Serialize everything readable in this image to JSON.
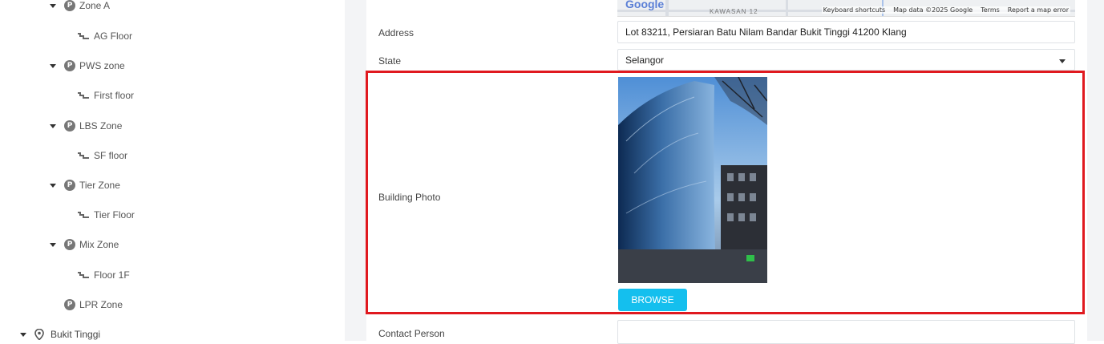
{
  "tree": {
    "nodes": [
      {
        "label": "Zone A",
        "type": "zone"
      },
      {
        "label": "AG Floor",
        "type": "floor"
      },
      {
        "label": "PWS zone",
        "type": "zone"
      },
      {
        "label": "First floor",
        "type": "floor"
      },
      {
        "label": "LBS Zone",
        "type": "zone"
      },
      {
        "label": "SF floor",
        "type": "floor"
      },
      {
        "label": "Tier Zone",
        "type": "zone"
      },
      {
        "label": "Tier Floor",
        "type": "floor"
      },
      {
        "label": "Mix Zone",
        "type": "zone"
      },
      {
        "label": "Floor 1F",
        "type": "floor"
      },
      {
        "label": "LPR Zone",
        "type": "zone"
      },
      {
        "label": "Bukit Tinggi",
        "type": "site"
      }
    ],
    "parking_icon_letter": "P"
  },
  "map": {
    "logo": "Google",
    "area_label": "KAWASAN 12",
    "footer": {
      "shortcuts": "Keyboard shortcuts",
      "data": "Map data ©2025 Google",
      "terms": "Terms",
      "report": "Report a map error"
    }
  },
  "form": {
    "address_label": "Address",
    "address_value": "Lot 83211, Persiaran Batu Nilam Bandar Bukit Tinggi 41200 Klang",
    "state_label": "State",
    "state_value": "Selangor",
    "photo_label": "Building Photo",
    "browse_label": "BROWSE",
    "contact_label": "Contact Person",
    "contact_value": ""
  },
  "colors": {
    "highlight": "#e0191f",
    "browse_button": "#14bfee",
    "gutter": "#f3f4f6"
  }
}
